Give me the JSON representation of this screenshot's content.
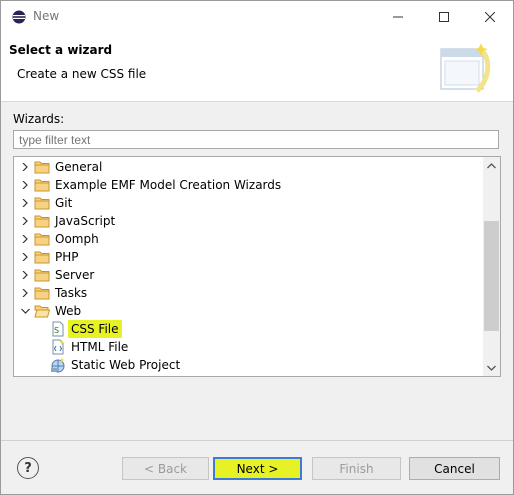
{
  "window": {
    "title": "New"
  },
  "header": {
    "title": "Select a wizard",
    "description": "Create a new CSS file"
  },
  "wizards": {
    "label": "Wizards:",
    "filter_placeholder": "type filter text",
    "tree": [
      {
        "label": "General",
        "expanded": false
      },
      {
        "label": "Example EMF Model Creation Wizards",
        "expanded": false
      },
      {
        "label": "Git",
        "expanded": false
      },
      {
        "label": "JavaScript",
        "expanded": false
      },
      {
        "label": "Oomph",
        "expanded": false
      },
      {
        "label": "PHP",
        "expanded": false
      },
      {
        "label": "Server",
        "expanded": false
      },
      {
        "label": "Tasks",
        "expanded": false
      },
      {
        "label": "Web",
        "expanded": true,
        "children": [
          {
            "label": "CSS File",
            "icon": "css-file-icon",
            "selected": true
          },
          {
            "label": "HTML File",
            "icon": "html-file-icon"
          },
          {
            "label": "Static Web Project",
            "icon": "web-project-icon"
          }
        ]
      }
    ]
  },
  "buttons": {
    "help": "?",
    "back": "< Back",
    "next": "Next >",
    "finish": "Finish",
    "cancel": "Cancel"
  },
  "colors": {
    "highlight": "#e6f224",
    "focus": "#3d7bd6",
    "folder": "#e8b64a"
  }
}
